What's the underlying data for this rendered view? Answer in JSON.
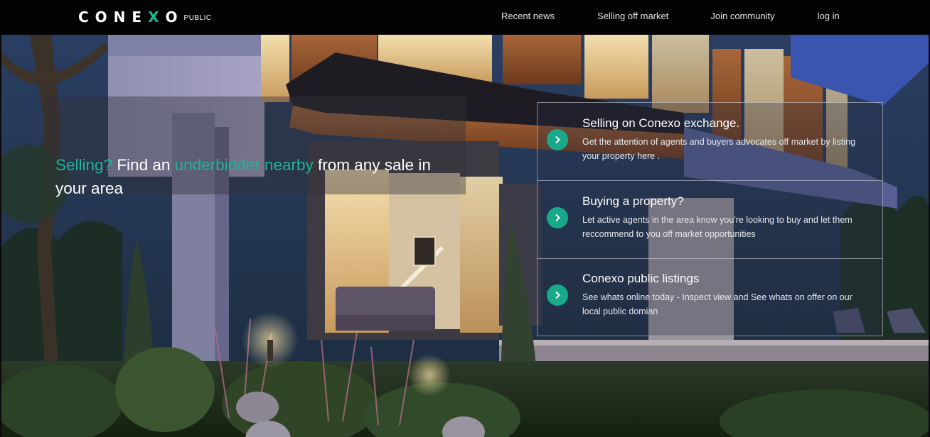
{
  "brand": {
    "name_pre": "CONE",
    "name_x": "X",
    "name_post": "O",
    "tag": "PUBLIC",
    "accent_color": "#19b896"
  },
  "nav": {
    "links": [
      {
        "label": "Recent news"
      },
      {
        "label": "Selling off market"
      },
      {
        "label": "Join community"
      },
      {
        "label": "log in"
      }
    ]
  },
  "hero": {
    "headline": {
      "part1": "Selling?",
      "part2": " Find an ",
      "part3": "underbidder nearby",
      "part4": " from any sale in your area"
    },
    "background": "modern house at dusk"
  },
  "cards": [
    {
      "title": "Selling on Conexo exchange.",
      "description": "Get the attention of agents and buyers advocates off market by listing your property here .",
      "icon": "chevron-right-icon"
    },
    {
      "title": "Buying a property?",
      "description": "Let active agents in the area know you're looking to buy and let them reccommend to you off market opportunities",
      "icon": "chevron-right-icon"
    },
    {
      "title": "Conexo public listings",
      "description": "See whats online today - Inspect view and See whats on offer on our local public domian",
      "icon": "chevron-right-icon"
    }
  ]
}
